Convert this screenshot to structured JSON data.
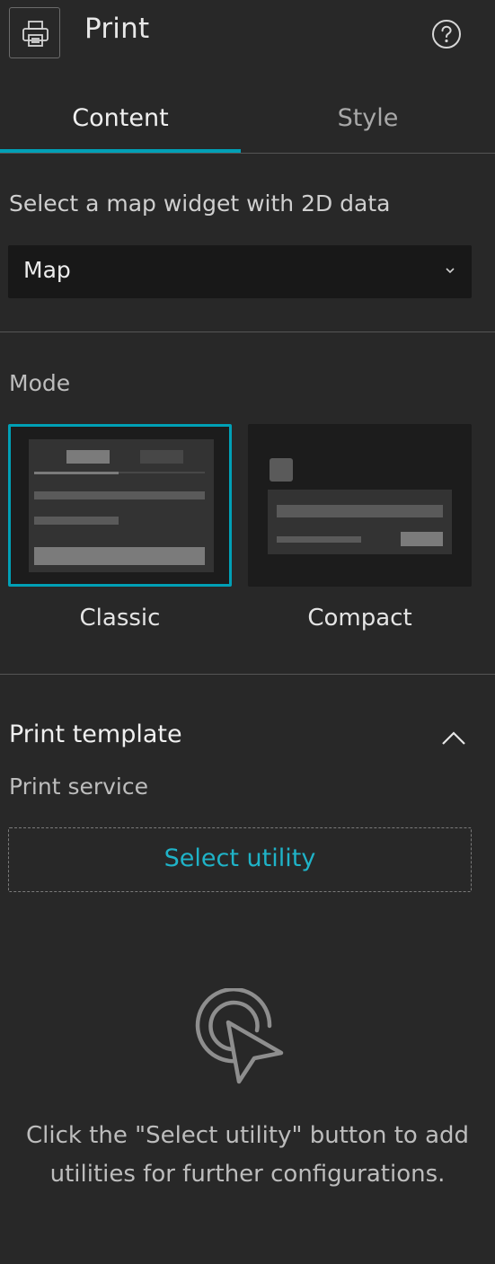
{
  "header": {
    "title": "Print",
    "icons": {
      "print": "printer-icon",
      "help": "help-icon"
    }
  },
  "tabs": [
    {
      "label": "Content",
      "active": true
    },
    {
      "label": "Style",
      "active": false
    }
  ],
  "map_widget": {
    "label": "Select a map widget with 2D data",
    "selected": "Map"
  },
  "mode": {
    "label": "Mode",
    "options": [
      {
        "label": "Classic",
        "selected": true
      },
      {
        "label": "Compact",
        "selected": false
      }
    ]
  },
  "print_template": {
    "title": "Print template",
    "service_label": "Print service",
    "select_button": "Select utility"
  },
  "empty_state": {
    "message": "Click the \"Select utility\" button to add utilities for further configurations."
  },
  "colors": {
    "accent": "#00a0b6",
    "background": "#282828",
    "input_bg": "#181818"
  }
}
